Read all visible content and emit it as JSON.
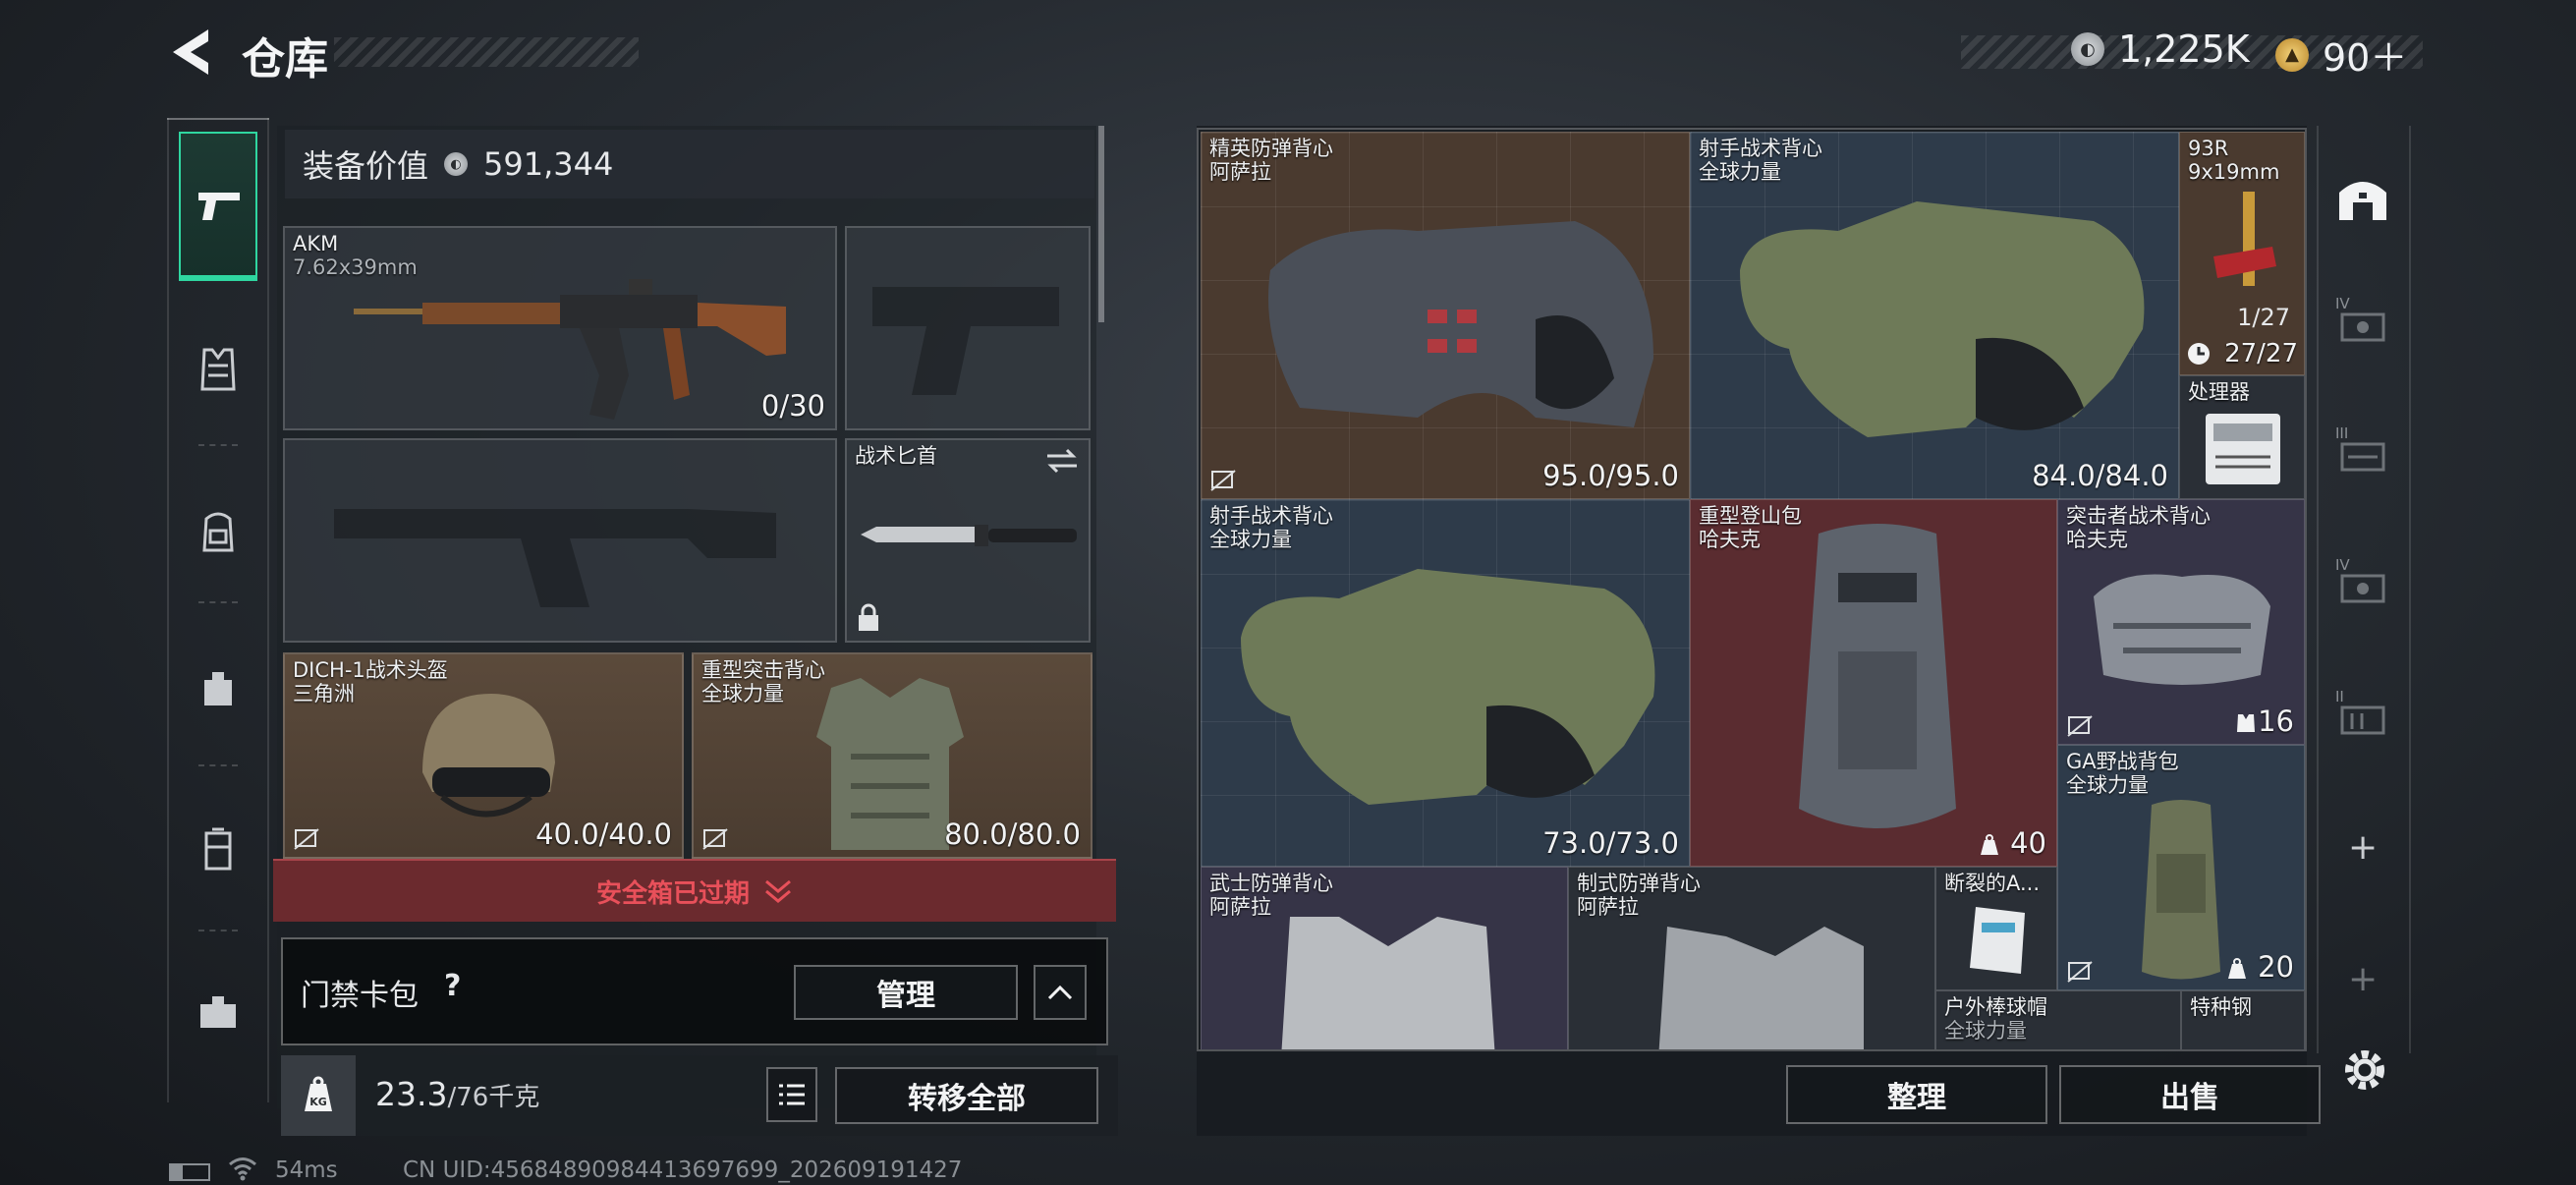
{
  "header": {
    "title": "仓库"
  },
  "currency": [
    {
      "icon": "silver-coin-icon",
      "amount": "1,225K"
    },
    {
      "icon": "gold-coin-icon",
      "amount": "90＋"
    }
  ],
  "loadout": {
    "value_label": "装备价值",
    "value": "591,344",
    "primary": {
      "name": "AKM",
      "caliber": "7.62x39mm",
      "ammo": "0/30"
    },
    "knife": {
      "name": "战术匕首"
    },
    "helmet": {
      "name": "DICH-1战术头盔",
      "faction": "三角洲",
      "durability": "40.0/40.0"
    },
    "armor": {
      "name": "重型突击背心",
      "faction": "全球力量",
      "durability": "80.0/80.0"
    },
    "safebox_expired": "安全箱已过期",
    "keycard_label": "门禁卡包",
    "keycard_help": "?",
    "manage_label": "管理",
    "weight": "23.3",
    "weight_cap": "/76千克",
    "weight_icon_text": "KG",
    "transfer_all": "转移全部"
  },
  "stash": {
    "items": [
      {
        "name": "精英防弹背心",
        "sub": "阿萨拉",
        "value": "95.0/95.0"
      },
      {
        "name": "射手战术背心",
        "sub": "全球力量",
        "value": "84.0/84.0"
      },
      {
        "name": "93R",
        "sub": "9x19mm",
        "ammo": "1/27",
        "value": "27/27"
      },
      {
        "name": "处理器"
      },
      {
        "name": "射手战术背心",
        "sub": "全球力量",
        "value": "73.0/73.0"
      },
      {
        "name": "重型登山包",
        "sub": "哈夫克",
        "value": "40"
      },
      {
        "name": "突击者战术背心",
        "sub": "哈夫克",
        "value": "16"
      },
      {
        "name": "GA野战背包",
        "sub": "全球力量",
        "value": "20"
      },
      {
        "name": "武士防弹背心",
        "sub": "阿萨拉"
      },
      {
        "name": "制式防弹背心",
        "sub": "阿萨拉"
      },
      {
        "name": "断裂的A..."
      },
      {
        "name": "户外棒球帽",
        "sub": "全球力量"
      },
      {
        "name": "特种钢"
      }
    ],
    "sort_label": "整理",
    "sell_label": "出售"
  },
  "right_nav": {
    "tier_labels": [
      "IV",
      "III",
      "IV",
      "II"
    ],
    "add": "+"
  },
  "status_bar": {
    "ping": "54ms",
    "uid": "CN UID:45684890984413697699_202609191427"
  },
  "colors": {
    "accent_green": "#2fd6a0",
    "alert_red": "#e8505a",
    "panel_red": "#6b2a2e"
  }
}
